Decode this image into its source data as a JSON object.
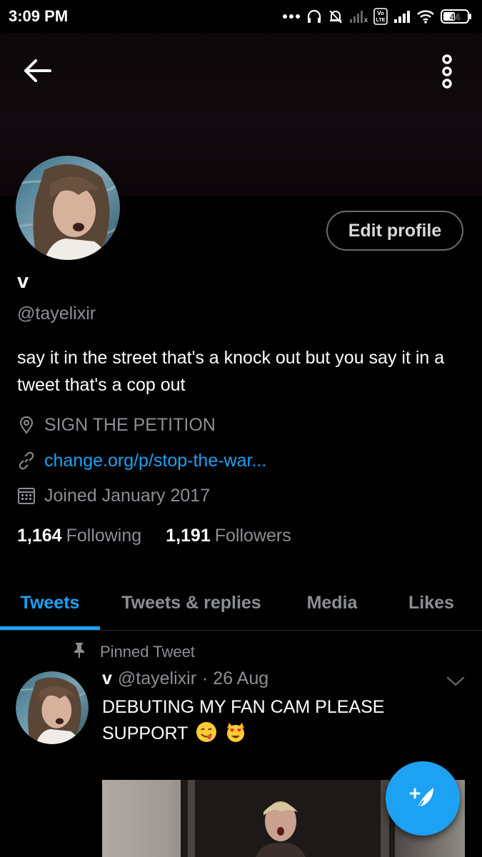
{
  "status_bar": {
    "time": "3:09 PM",
    "battery": "44",
    "volte": "Vo LTE"
  },
  "header": {
    "back_icon": "arrow-left-icon",
    "more_icon": "vertical-dots-icon"
  },
  "profile": {
    "edit_label": "Edit profile",
    "display_name": "v",
    "handle": "@tayelixir",
    "bio": "say it in the street that's a knock out but you say it in a tweet that's a cop out",
    "location": "SIGN THE PETITION",
    "website": "change.org/p/stop-the-war...",
    "joined": "Joined January 2017",
    "following_count": "1,164",
    "following_label": "Following",
    "followers_count": "1,191",
    "followers_label": "Followers"
  },
  "tabs": [
    {
      "label": "Tweets",
      "active": true
    },
    {
      "label": "Tweets & replies",
      "active": false
    },
    {
      "label": "Media",
      "active": false
    },
    {
      "label": "Likes",
      "active": false
    }
  ],
  "tweet": {
    "pinned_label": "Pinned Tweet",
    "name": "v",
    "handle": "@tayelixir",
    "date": "· 26 Aug",
    "text": "DEBUTING MY FAN CAM PLEASE SUPPORT"
  },
  "colors": {
    "accent": "#1da1f2",
    "background": "#000000",
    "secondary_text": "#8b8f94"
  }
}
